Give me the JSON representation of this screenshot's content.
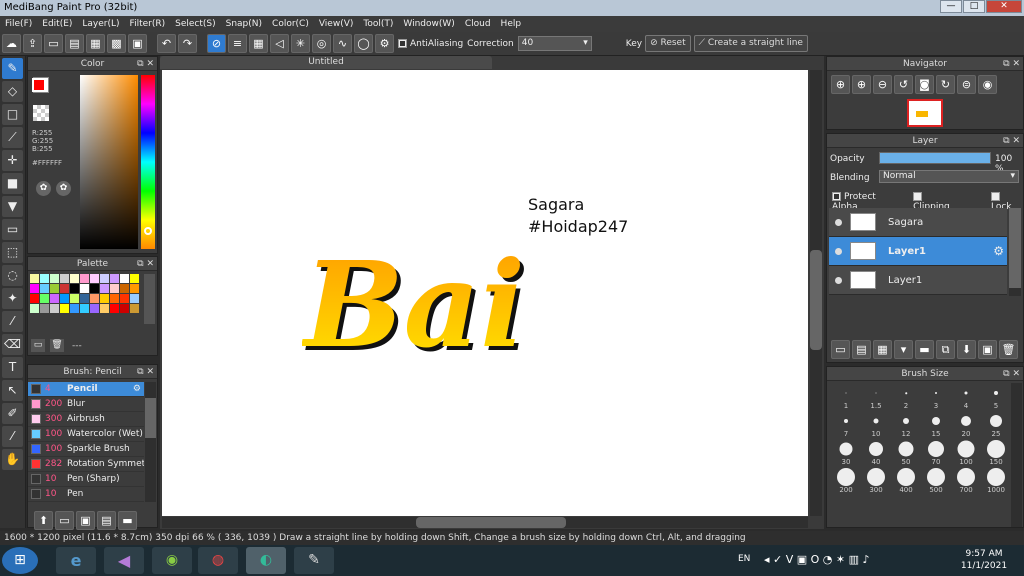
{
  "window": {
    "title": "MediBang Paint Pro (32bit)",
    "controls": [
      "—",
      "□",
      "✕"
    ]
  },
  "menu": [
    "File(F)",
    "Edit(E)",
    "Layer(L)",
    "Filter(R)",
    "Select(S)",
    "Snap(N)",
    "Color(C)",
    "View(V)",
    "Tool(T)",
    "Window(W)",
    "Cloud",
    "Help"
  ],
  "toolbar": {
    "antialias_label": "AntiAliasing",
    "antialias_checked": true,
    "correction_label": "Correction",
    "correction_value": "40",
    "key_label": "Key",
    "reset_label": "Reset",
    "straight_line_label": "Create a straight line"
  },
  "color_panel": {
    "title": "Color",
    "r": "R:255",
    "g": "G:255",
    "b": "B:255",
    "hex": "#FFFFFF",
    "fg": "#ff0000",
    "bg": "#ffffff"
  },
  "palette_panel": {
    "title": "Palette",
    "footer_text": "---"
  },
  "brush_panel": {
    "title": "Brush: Pencil",
    "items": [
      {
        "size": "4",
        "name": "Pencil",
        "color": "#333333",
        "selected": true
      },
      {
        "size": "200",
        "name": "Blur",
        "color": "#ff99cc",
        "selected": false
      },
      {
        "size": "300",
        "name": "Airbrush",
        "color": "#ffccee",
        "selected": false
      },
      {
        "size": "100",
        "name": "Watercolor (Wet)",
        "color": "#66ccff",
        "selected": false
      },
      {
        "size": "100",
        "name": "Sparkle Brush",
        "color": "#3366ff",
        "selected": false
      },
      {
        "size": "282",
        "name": "Rotation Symmetr",
        "color": "#ff3333",
        "selected": false
      },
      {
        "size": "10",
        "name": "Pen (Sharp)",
        "color": "#333333",
        "selected": false
      },
      {
        "size": "10",
        "name": "Pen",
        "color": "#333333",
        "selected": false
      }
    ]
  },
  "document": {
    "tab": "Untitled",
    "text_line1": "Sagara",
    "text_line2": "#Hoidap247",
    "lettering": "Bai"
  },
  "navigator": {
    "title": "Navigator"
  },
  "layer_panel": {
    "title": "Layer",
    "opacity_label": "Opacity",
    "opacity_value": "100 %",
    "opacity": 1.0,
    "blending_label": "Blending",
    "blending_value": "Normal",
    "protect_alpha_label": "Protect Alpha",
    "clipping_label": "Clipping",
    "lock_label": "Lock",
    "layers": [
      {
        "name": "Sagara",
        "selected": false
      },
      {
        "name": "Layer1",
        "selected": true
      },
      {
        "name": "Layer1",
        "selected": false
      }
    ]
  },
  "brush_size": {
    "title": "Brush Size",
    "sizes": [
      "1",
      "1.5",
      "2",
      "3",
      "4",
      "5",
      "7",
      "10",
      "12",
      "15",
      "20",
      "25",
      "30",
      "40",
      "50",
      "70",
      "100",
      "150",
      "200",
      "300",
      "400",
      "500",
      "700",
      "1000"
    ]
  },
  "status": {
    "dimensions": "1600 * 1200 pixel",
    "physical": "(11.6 * 8.7cm)",
    "dpi": "350 dpi",
    "zoom": "66 %",
    "coords": "( 336, 1039 )",
    "hint": "Draw a straight line by holding down Shift, Change a brush size by holding down Ctrl, Alt, and dragging"
  },
  "taskbar": {
    "lang": "EN",
    "time": "9:57 AM",
    "date": "11/1/2021"
  }
}
